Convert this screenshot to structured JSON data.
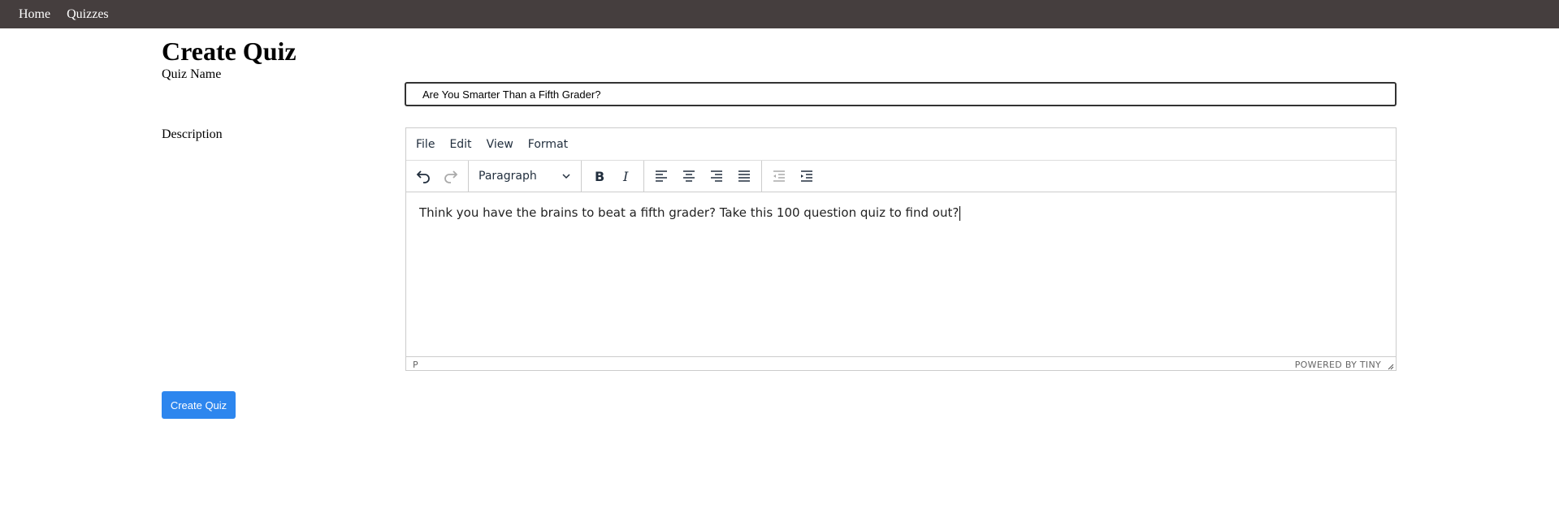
{
  "nav": {
    "home": "Home",
    "quizzes": "Quizzes"
  },
  "page": {
    "title": "Create Quiz"
  },
  "form": {
    "quiz_name_label": "Quiz Name",
    "quiz_name_value": "Are You Smarter Than a Fifth Grader?",
    "description_label": "Description",
    "submit_label": "Create Quiz"
  },
  "editor": {
    "menu": [
      "File",
      "Edit",
      "View",
      "Format"
    ],
    "block_format": "Paragraph",
    "toolbar_icons": [
      "undo-icon",
      "redo-icon",
      "bold-icon",
      "italic-icon",
      "align-left-icon",
      "align-center-icon",
      "align-right-icon",
      "align-justify-icon",
      "outdent-icon",
      "indent-icon"
    ],
    "content": "Think you have the brains to beat a fifth grader? Take this 100 question quiz to find out?",
    "path": "P",
    "branding": "POWERED BY TINY"
  },
  "colors": {
    "navbar": "#453e3e",
    "button": "#2d86ee"
  }
}
